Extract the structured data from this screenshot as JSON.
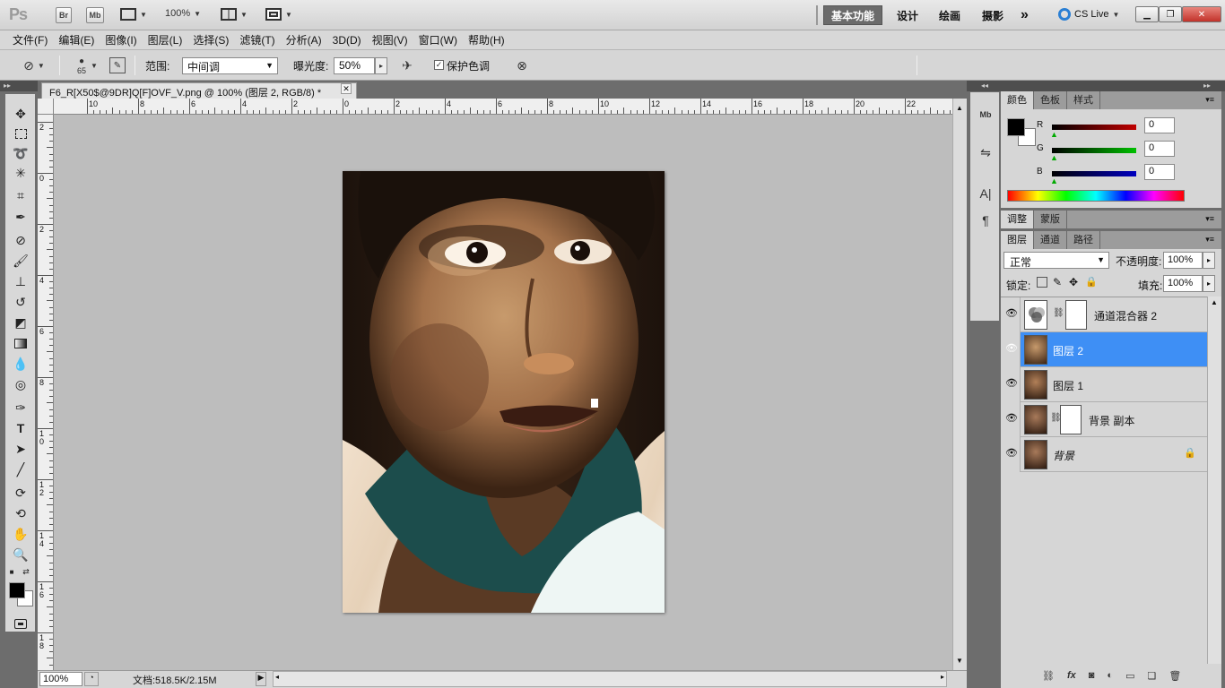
{
  "titlebar": {
    "app_logo": "Ps",
    "bridge": "Br",
    "mini_bridge": "Mb",
    "zoom": "100%",
    "workspaces": [
      "基本功能",
      "设计",
      "绘画",
      "摄影"
    ],
    "more": "»",
    "cs_live": "CS Live"
  },
  "menu": [
    "文件(F)",
    "编辑(E)",
    "图像(I)",
    "图层(L)",
    "选择(S)",
    "滤镜(T)",
    "分析(A)",
    "3D(D)",
    "视图(V)",
    "窗口(W)",
    "帮助(H)"
  ],
  "options": {
    "brush_size": "65",
    "range_label": "范围:",
    "range_value": "中间调",
    "exposure_label": "曝光度:",
    "exposure_value": "50%",
    "protect_tones_label": "保护色调",
    "protect_tones_checked": true
  },
  "document": {
    "tab_title": "F6_R[X50$@9DR]Q[F]OVF_V.png @ 100% (图层 2, RGB/8) *",
    "ruler_h": [
      "10",
      "8",
      "6",
      "4",
      "2",
      "0",
      "2",
      "4",
      "6",
      "8",
      "10",
      "12",
      "14",
      "16",
      "18",
      "20",
      "22"
    ],
    "ruler_v": [
      "2",
      "0",
      "2",
      "4",
      "6",
      "8",
      "10",
      "12",
      "14",
      "16",
      "18"
    ]
  },
  "status": {
    "zoom": "100%",
    "doc_info": "文档:518.5K/2.15M"
  },
  "panels": {
    "color_tabs": [
      "颜色",
      "色板",
      "样式"
    ],
    "color": {
      "channels": [
        {
          "label": "R",
          "value": "0",
          "color": "#c00000"
        },
        {
          "label": "G",
          "value": "0",
          "color": "#00b000"
        },
        {
          "label": "B",
          "value": "0",
          "color": "#0000c0"
        }
      ]
    },
    "adjust_tabs": [
      "调整",
      "蒙版"
    ],
    "layer_tabs": [
      "图层",
      "通道",
      "路径"
    ],
    "blend_mode": "正常",
    "opacity_label": "不透明度:",
    "opacity_value": "100%",
    "lock_label": "锁定:",
    "fill_label": "填充:",
    "fill_value": "100%",
    "layers": [
      {
        "name": "通道混合器 2",
        "type": "adjustment",
        "selected": false
      },
      {
        "name": "图层 2",
        "type": "image",
        "selected": true
      },
      {
        "name": "图层 1",
        "type": "image",
        "selected": false
      },
      {
        "name": "背景 副本",
        "type": "image-mask",
        "selected": false
      },
      {
        "name": "背景",
        "type": "background",
        "selected": false
      }
    ]
  },
  "colors": {
    "accent_selection": "#3e8ff5",
    "foreground": "#000000",
    "background": "#ffffff"
  }
}
